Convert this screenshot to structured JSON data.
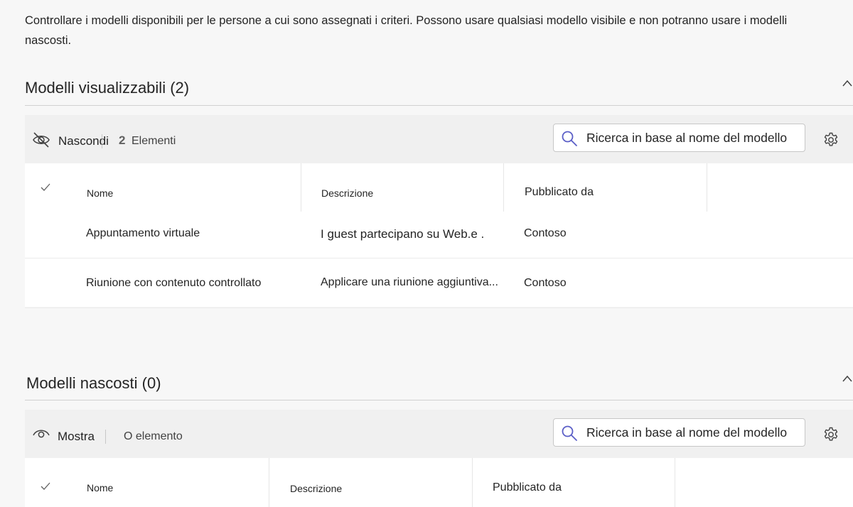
{
  "intro": {
    "text": "Controllare i modelli disponibili per le persone a cui sono assegnati i criteri. Possono usare qualsiasi modello visibile e non potranno usare i modelli nascosti."
  },
  "visible_section": {
    "title": "Modelli visualizzabili (2)",
    "action_label": "Nascondi",
    "count": "2",
    "count_label": "Elementi",
    "search_placeholder": "Ricerca in base al nome del modello",
    "columns": [
      "Nome",
      "Descrizione",
      "Pubblicato da"
    ],
    "rows": [
      {
        "name": "Appuntamento virtuale",
        "description": "I guest partecipano su Web.e .",
        "publisher": "Contoso"
      },
      {
        "name": "Riunione con contenuto controllato",
        "description": "Applicare una riunione aggiuntiva...",
        "publisher": "Contoso"
      }
    ]
  },
  "hidden_section": {
    "title": "Modelli nascosti (0)",
    "action_label": "Mostra",
    "count_label": "O elemento",
    "search_placeholder": "Ricerca in base al nome del modello",
    "columns": [
      "Nome",
      "Descrizione",
      "Pubblicato da"
    ]
  },
  "icons": {
    "hide": "eye-off-icon",
    "show": "eye-icon",
    "search": "search-icon",
    "settings": "gear-icon",
    "collapse": "chevron-up-icon",
    "select_all": "checkmark-icon"
  },
  "colors": {
    "accent": "#5b5fc7",
    "background": "#f7f7f7",
    "toolbar": "#f0f0f0"
  }
}
